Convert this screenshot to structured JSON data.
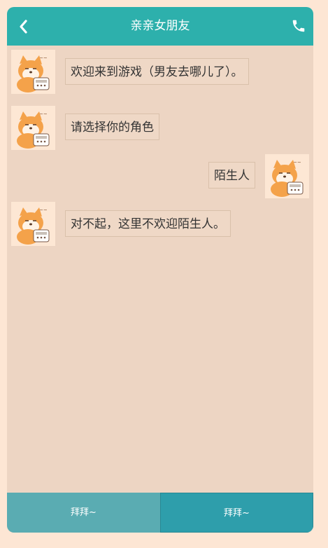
{
  "header": {
    "title": "亲亲女朋友",
    "back_icon": "chevron-left-icon",
    "call_icon": "phone-icon",
    "color": "#2db0ac"
  },
  "messages": [
    {
      "sender": "bot",
      "avatar_icon": "shiba-dog-avatar",
      "text": "欢迎来到游戏（男友去哪儿了）。"
    },
    {
      "sender": "bot",
      "avatar_icon": "shiba-dog-avatar",
      "text": "请选择你的角色"
    },
    {
      "sender": "user",
      "avatar_icon": "shiba-dog-avatar",
      "text": "陌生人"
    },
    {
      "sender": "bot",
      "avatar_icon": "shiba-dog-avatar",
      "text": "对不起，这里不欢迎陌生人。"
    }
  ],
  "footer": {
    "left_label": "拜拜~",
    "right_label": "拜拜~"
  },
  "colors": {
    "page_bg": "#fde6d4",
    "chat_bg": "#edd5c3",
    "footer_left": "#5aacb2",
    "footer_right": "#2e9eab"
  }
}
